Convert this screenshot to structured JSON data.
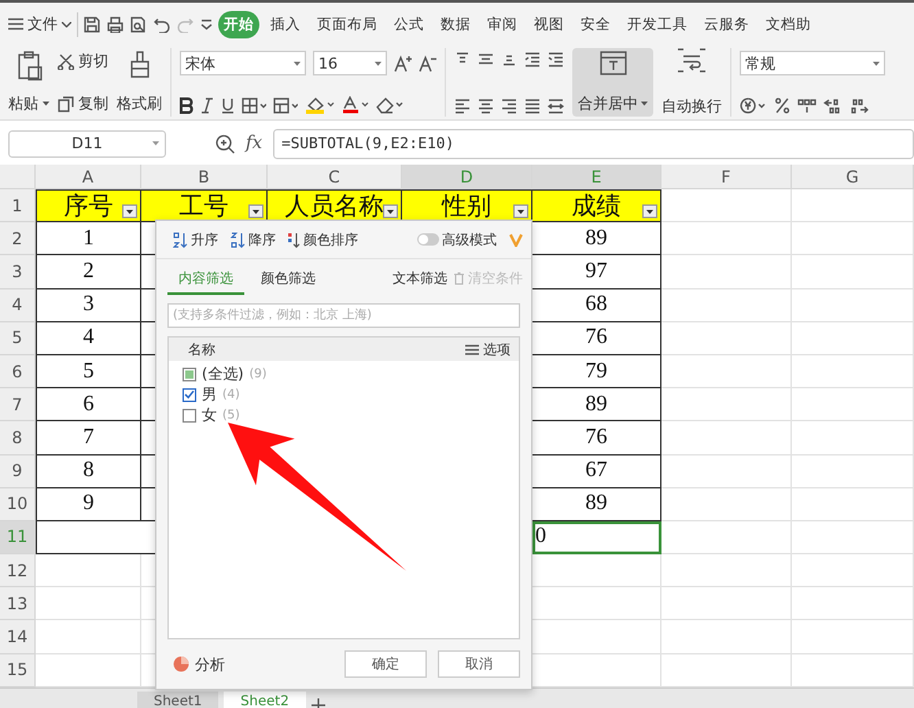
{
  "menu_bar": {
    "menu_label": "文件",
    "tabs": [
      {
        "label": "开始",
        "selected": true
      },
      {
        "label": "插入",
        "selected": false
      },
      {
        "label": "页面布局",
        "selected": false
      },
      {
        "label": "公式",
        "selected": false
      },
      {
        "label": "数据",
        "selected": false
      },
      {
        "label": "审阅",
        "selected": false
      },
      {
        "label": "视图",
        "selected": false
      },
      {
        "label": "安全",
        "selected": false
      },
      {
        "label": "开发工具",
        "selected": false
      },
      {
        "label": "云服务",
        "selected": false
      },
      {
        "label": "文档助",
        "selected": false
      }
    ]
  },
  "ribbon": {
    "paste": "粘贴",
    "cut": "剪切",
    "copy": "复制",
    "format_painter": "格式刷",
    "font": "宋体",
    "font_size": "16",
    "merge": "合并居中",
    "wrap": "自动换行",
    "number_format": "常规"
  },
  "formula_bar": {
    "cell": "D11",
    "fx_label": "fx",
    "formula": "=SUBTOTAL(9,E2:E10)"
  },
  "sheet": {
    "columns": [
      {
        "label": "A",
        "selected": false
      },
      {
        "label": "B",
        "selected": false
      },
      {
        "label": "C",
        "selected": false
      },
      {
        "label": "D",
        "selected": true
      },
      {
        "label": "E",
        "selected": true
      },
      {
        "label": "F",
        "selected": false
      },
      {
        "label": "G",
        "selected": false
      }
    ],
    "rows": [
      {
        "number": "1",
        "kind": "header",
        "selected": false,
        "cells": {
          "A": "序号",
          "B": "工号",
          "C": "人员名称",
          "D": "性别",
          "E": "成绩"
        }
      },
      {
        "number": "2",
        "kind": "data",
        "selected": false,
        "cells": {
          "A": "1",
          "E": "89"
        }
      },
      {
        "number": "3",
        "kind": "data",
        "selected": false,
        "cells": {
          "A": "2",
          "E": "97"
        }
      },
      {
        "number": "4",
        "kind": "data",
        "selected": false,
        "cells": {
          "A": "3",
          "E": "68"
        }
      },
      {
        "number": "5",
        "kind": "data",
        "selected": false,
        "cells": {
          "A": "4",
          "E": "76"
        }
      },
      {
        "number": "6",
        "kind": "data",
        "selected": false,
        "cells": {
          "A": "5",
          "E": "79"
        }
      },
      {
        "number": "7",
        "kind": "data",
        "selected": false,
        "cells": {
          "A": "6",
          "E": "89"
        }
      },
      {
        "number": "8",
        "kind": "data",
        "selected": false,
        "cells": {
          "A": "7",
          "E": "76"
        }
      },
      {
        "number": "9",
        "kind": "data",
        "selected": false,
        "cells": {
          "A": "8",
          "E": "67"
        }
      },
      {
        "number": "10",
        "kind": "data",
        "selected": false,
        "cells": {
          "A": "9",
          "E": "89"
        }
      },
      {
        "number": "11",
        "kind": "total",
        "selected": true,
        "cells": {
          "E": "0"
        }
      },
      {
        "number": "12",
        "kind": "empty",
        "selected": false
      },
      {
        "number": "13",
        "kind": "empty",
        "selected": false
      },
      {
        "number": "14",
        "kind": "empty",
        "selected": false
      },
      {
        "number": "15",
        "kind": "empty",
        "selected": false
      }
    ]
  },
  "filter_panel": {
    "sort": [
      {
        "kind": "ascending",
        "label": "升序"
      },
      {
        "kind": "descending",
        "label": "降序"
      },
      {
        "kind": "color",
        "label": "颜色排序"
      }
    ],
    "advanced": {
      "label": "高级模式",
      "on": false
    },
    "tabs": [
      {
        "label": "内容筛选",
        "selected": true
      },
      {
        "label": "颜色筛选",
        "selected": false
      }
    ],
    "text_filter": "文本筛选",
    "clear": {
      "label": "清空条件",
      "disabled": true
    },
    "search": {
      "placeholder": "(支持多条件过滤，例如：北京 上海)"
    },
    "list_header": "名称",
    "options": "选项",
    "select_all": {
      "label": "(全选)",
      "count": "(9)",
      "partial": true
    },
    "items": [
      {
        "label": "男",
        "count": "(4)",
        "checked": true
      },
      {
        "label": "女",
        "count": "(5)",
        "checked": false
      }
    ],
    "analyze": "分析",
    "buttons": [
      "确定",
      "取消"
    ]
  },
  "sheet_tabs": [
    {
      "label": "Sheet1",
      "selected": false
    },
    {
      "label": "Sheet2",
      "selected": true
    }
  ]
}
